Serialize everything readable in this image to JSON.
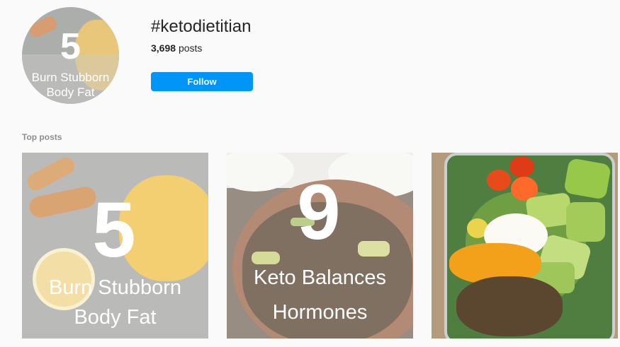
{
  "header": {
    "tag_name": "#ketodietitian",
    "post_count": "3,698",
    "post_suffix": "posts",
    "follow_label": "Follow",
    "avatar": {
      "number": "5",
      "line1": "Burn Stubborn",
      "line2": "Body Fat"
    }
  },
  "section": {
    "top_posts_label": "Top posts"
  },
  "posts": [
    {
      "number": "5",
      "line1": "Burn Stubborn",
      "line2": "Body Fat"
    },
    {
      "number": "9",
      "line1": "Keto Balances",
      "line2": "Hormones"
    },
    {}
  ]
}
